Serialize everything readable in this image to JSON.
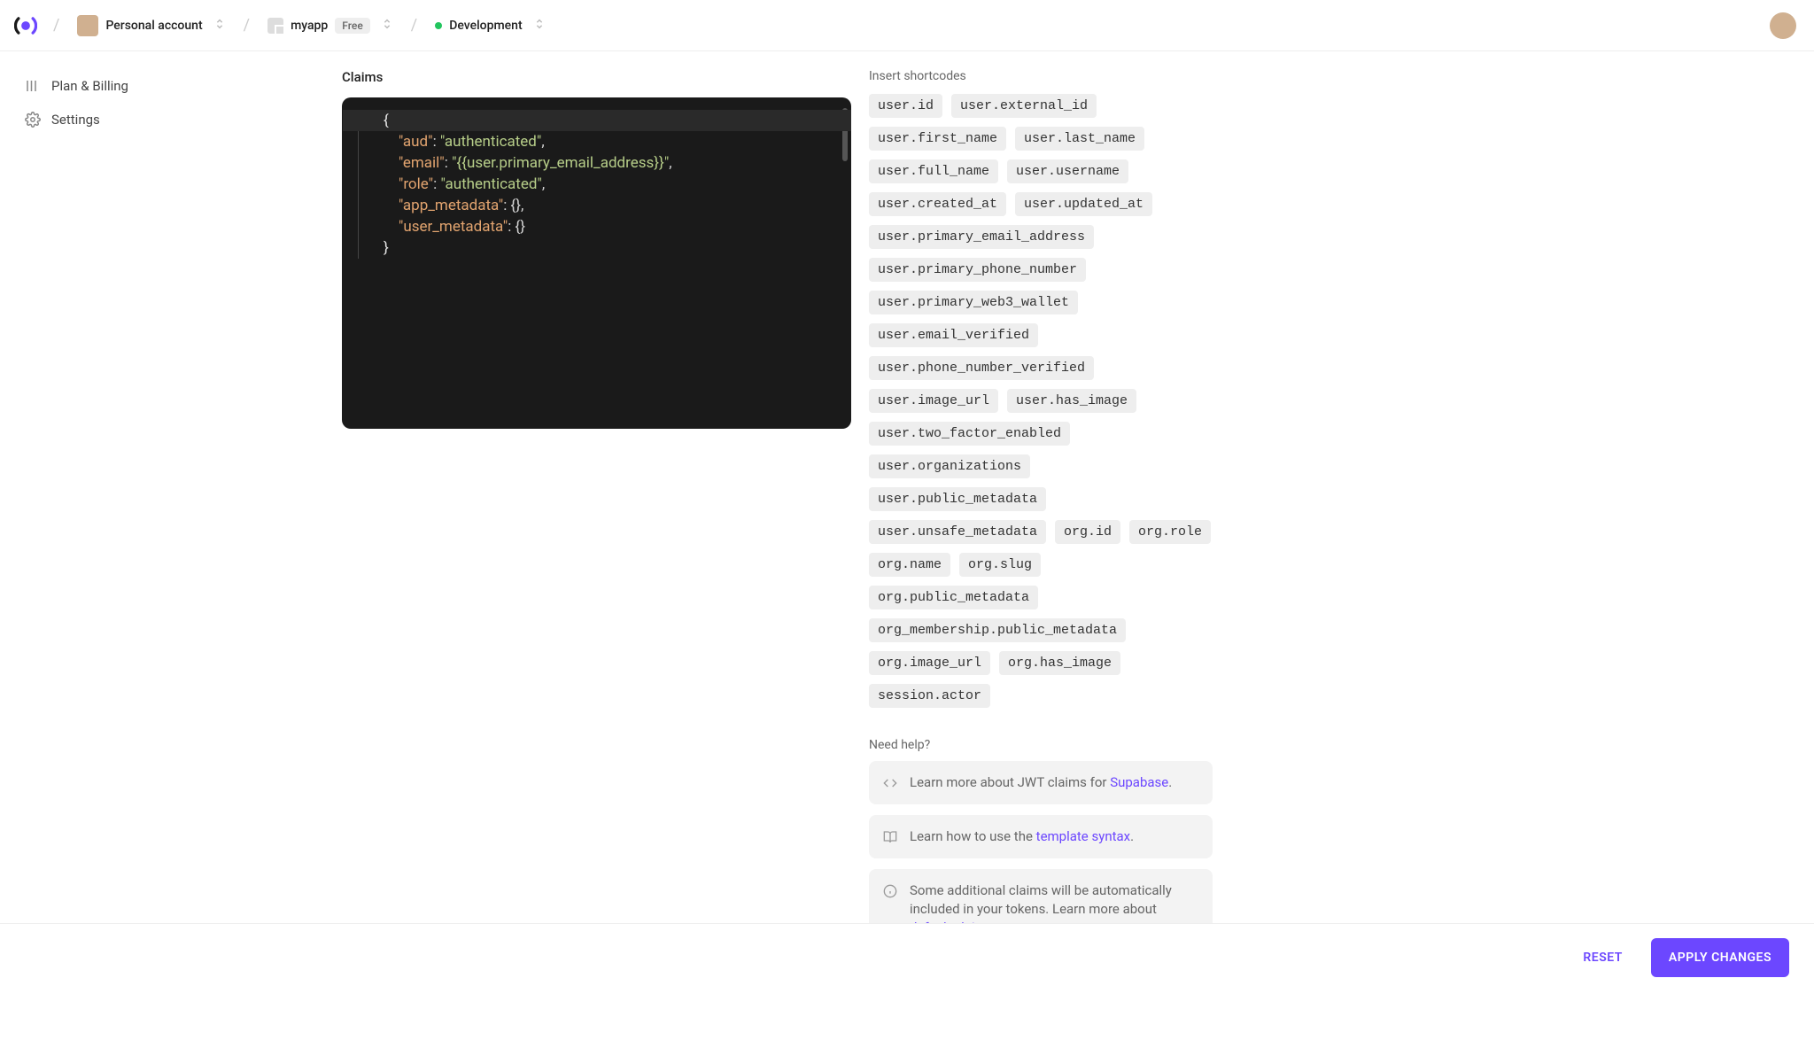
{
  "header": {
    "account_label": "Personal account",
    "app_name": "myapp",
    "app_plan": "Free",
    "env_name": "Development"
  },
  "sidebar": {
    "items": [
      {
        "label": "Plan & Billing"
      },
      {
        "label": "Settings"
      }
    ]
  },
  "claims": {
    "title": "Claims",
    "json": {
      "aud": "authenticated",
      "email": "{{user.primary_email_address}}",
      "role": "authenticated",
      "app_metadata": {},
      "user_metadata": {}
    }
  },
  "shortcodes": {
    "title": "Insert shortcodes",
    "items": [
      "user.id",
      "user.external_id",
      "user.first_name",
      "user.last_name",
      "user.full_name",
      "user.username",
      "user.created_at",
      "user.updated_at",
      "user.primary_email_address",
      "user.primary_phone_number",
      "user.primary_web3_wallet",
      "user.email_verified",
      "user.phone_number_verified",
      "user.image_url",
      "user.has_image",
      "user.two_factor_enabled",
      "user.organizations",
      "user.public_metadata",
      "user.unsafe_metadata",
      "org.id",
      "org.role",
      "org.name",
      "org.slug",
      "org.public_metadata",
      "org_membership.public_metadata",
      "org.image_url",
      "org.has_image",
      "session.actor"
    ]
  },
  "help": {
    "title": "Need help?",
    "card1_pre": "Learn more about JWT claims for ",
    "card1_link": "Supabase",
    "card1_post": ".",
    "card2_pre": "Learn how to use the ",
    "card2_link": "template syntax",
    "card2_post": ".",
    "card3_pre": "Some additional claims will be automatically included in your tokens. Learn more about ",
    "card3_link": "default claims",
    "card3_post": "."
  },
  "footer": {
    "reset": "RESET",
    "apply": "APPLY CHANGES"
  }
}
